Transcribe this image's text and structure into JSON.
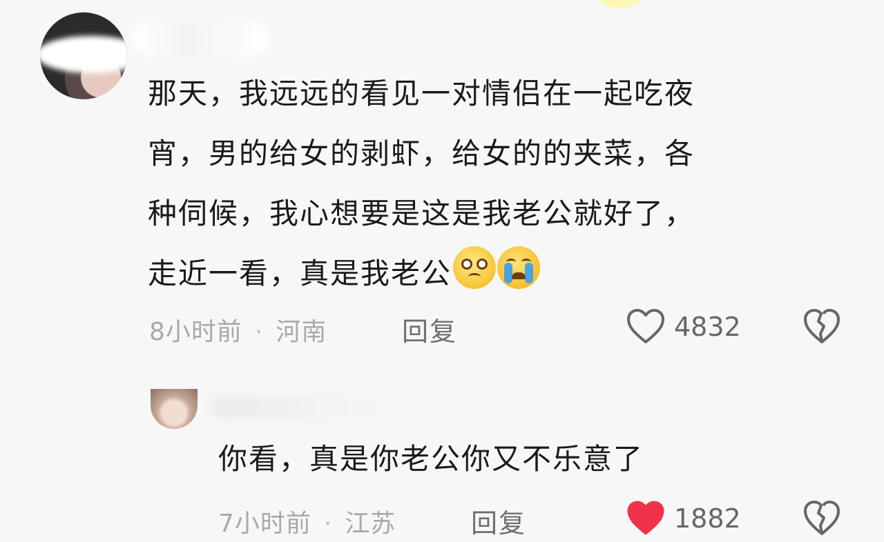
{
  "main_comment": {
    "lines": [
      "那天，我远远的看见一对情侣在一起吃夜",
      "宵，男的给女的剥虾，给女的的夹菜，各",
      "种伺候，我心想要是这是我老公就好了，",
      "走近一看，真是我老公"
    ],
    "emojis": [
      "pleading-face-icon",
      "crying-face-icon"
    ],
    "time": "8小时前",
    "separator": "·",
    "location": "河南",
    "reply_label": "回复",
    "like_count": "4832",
    "liked": false
  },
  "reply_comment": {
    "text": "你看，真是你老公你又不乐意了",
    "time": "7小时前",
    "separator": "·",
    "location": "江苏",
    "reply_label": "回复",
    "like_count": "1882",
    "liked": true
  },
  "colors": {
    "background": "#f7f7f7",
    "text": "#1a1a1a",
    "meta": "#a9a9a9",
    "liked_heart": "#f0324a",
    "icon_outline": "#666666"
  }
}
